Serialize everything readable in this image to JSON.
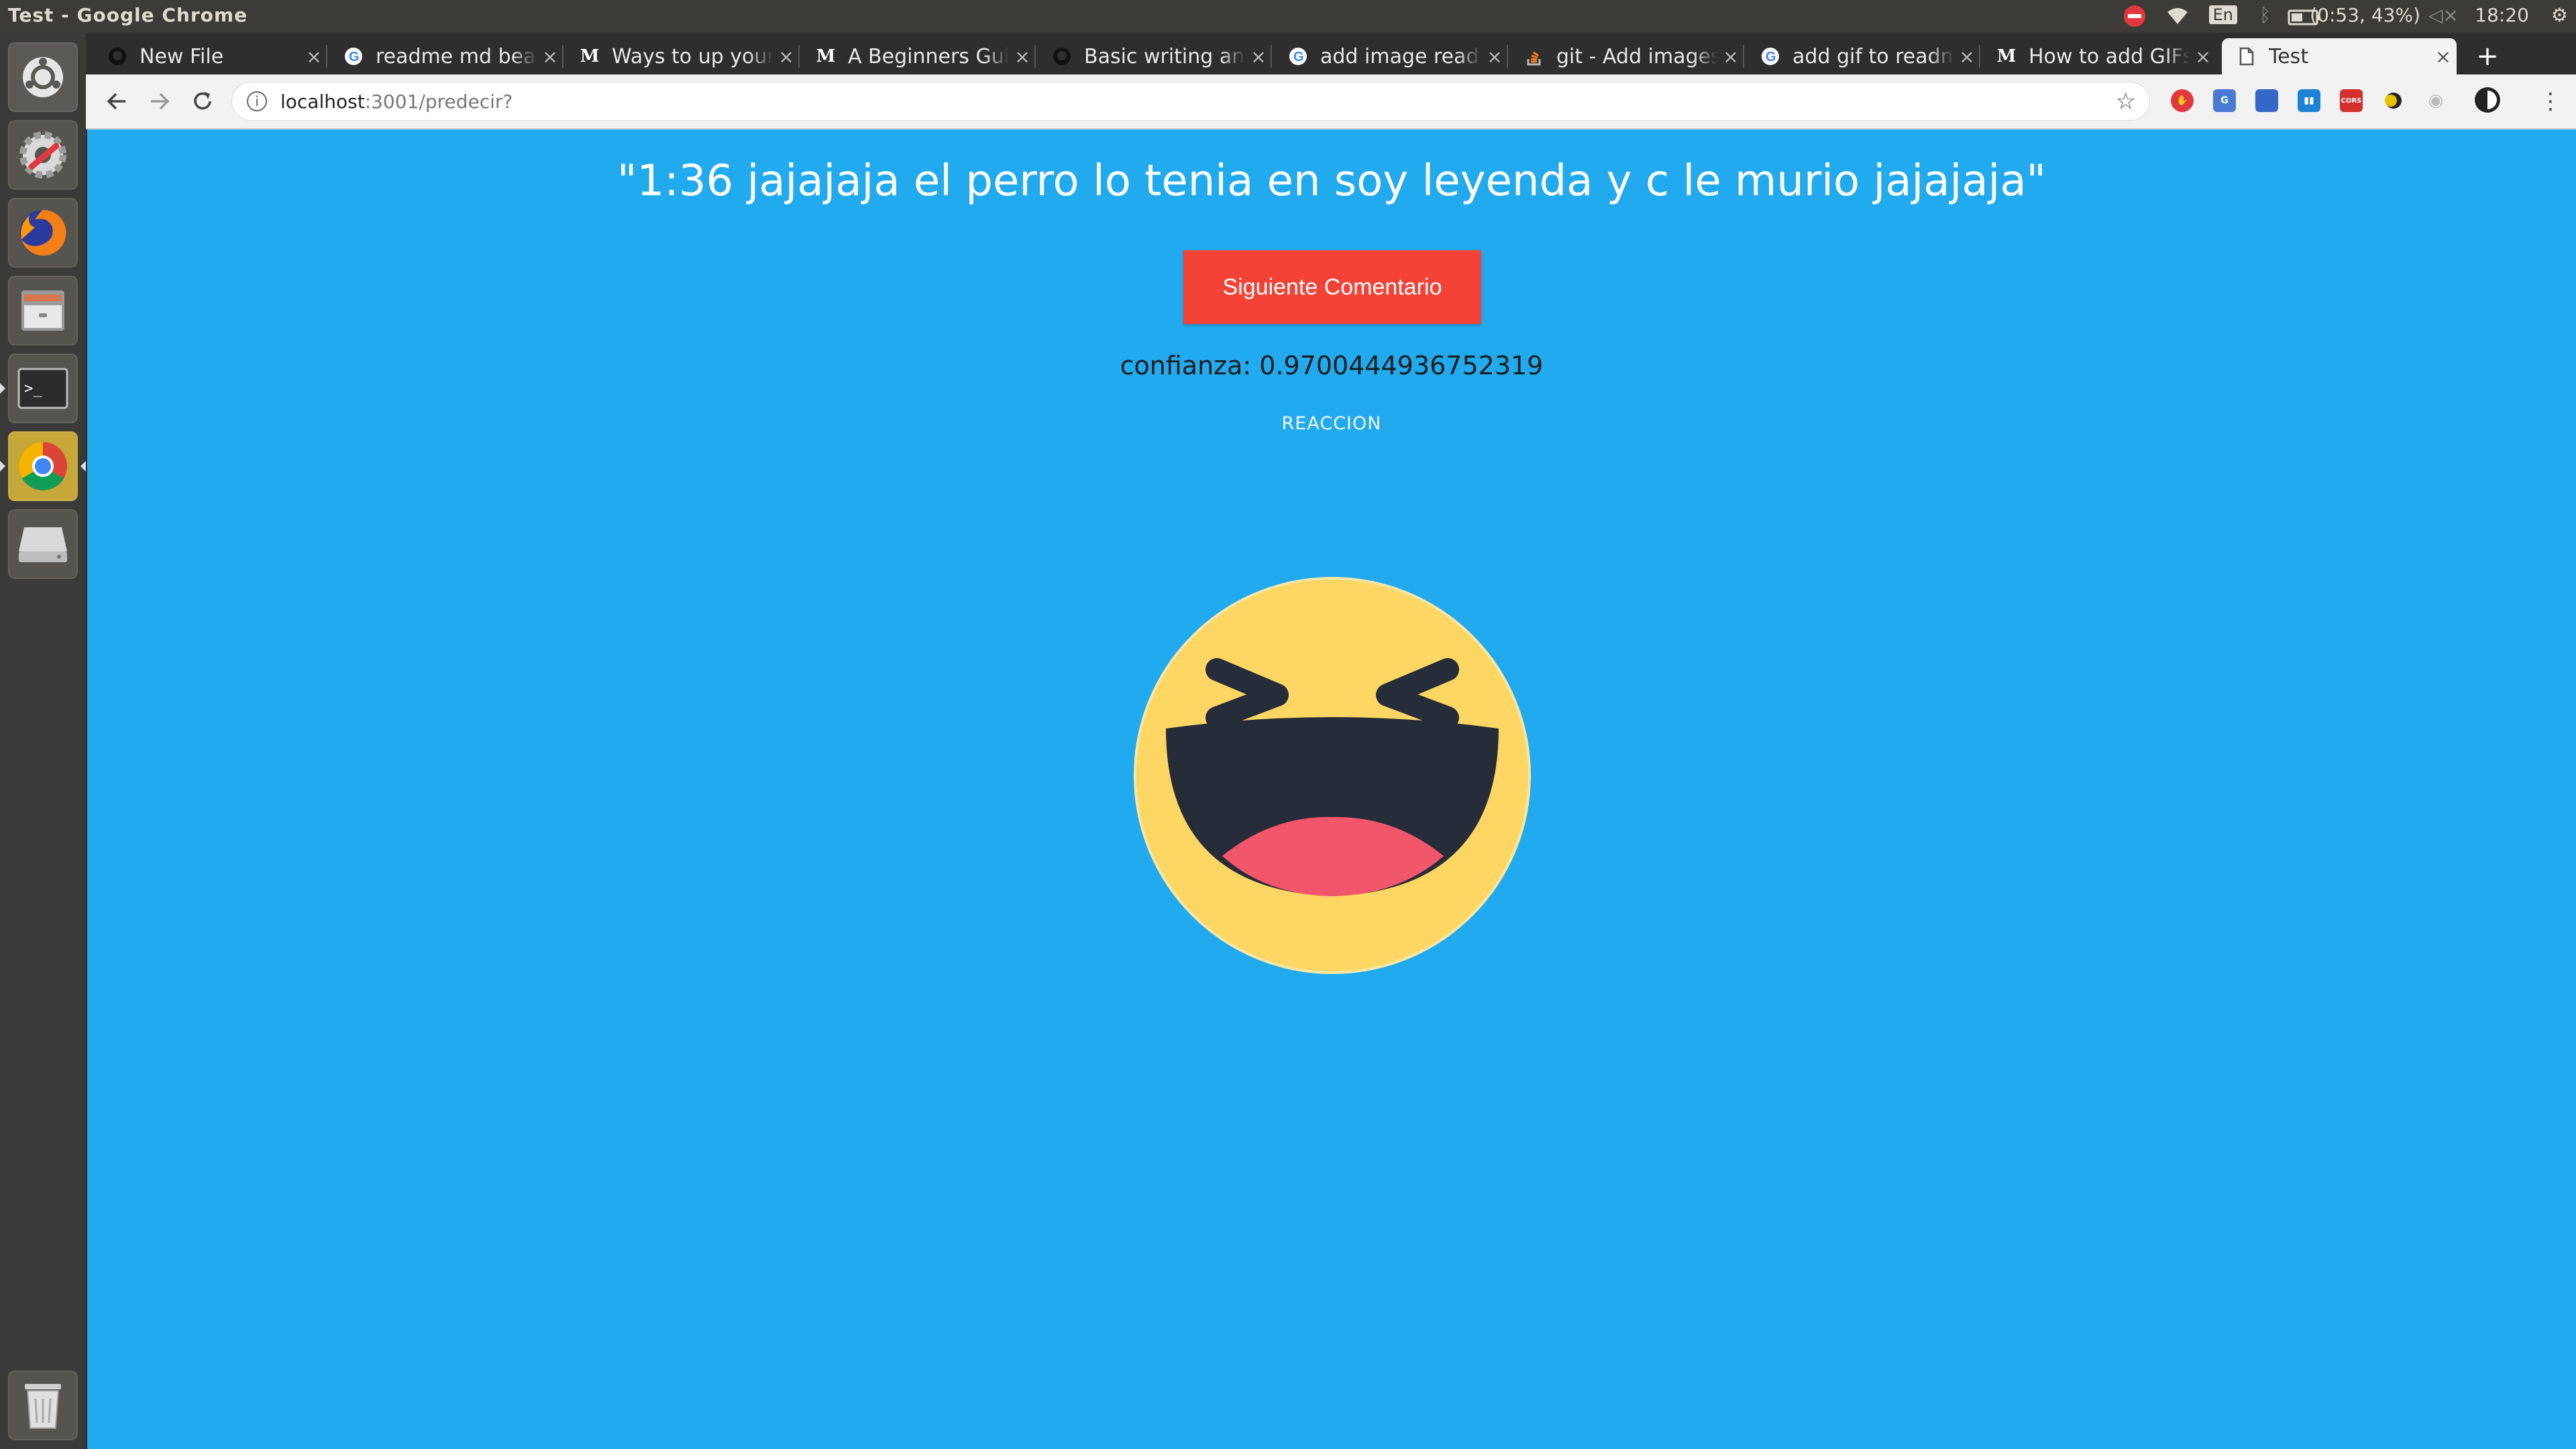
{
  "os": {
    "window_title": "Test - Google Chrome",
    "indicators": {
      "keyboard_layout": "En",
      "battery": "(0:53, 43%)",
      "clock": "18:20"
    },
    "launcher_items": [
      {
        "name": "ubuntu-dash-icon"
      },
      {
        "name": "system-settings-icon"
      },
      {
        "name": "firefox-icon"
      },
      {
        "name": "file-manager-icon"
      },
      {
        "name": "terminal-icon"
      },
      {
        "name": "chrome-icon"
      },
      {
        "name": "disk-drive-icon"
      },
      {
        "name": "trash-icon"
      }
    ]
  },
  "browser": {
    "tabs": [
      {
        "title": "New File",
        "favicon": "github-icon"
      },
      {
        "title": "readme md beautiful",
        "favicon": "google-icon"
      },
      {
        "title": "Ways to up your",
        "favicon": "medium-icon"
      },
      {
        "title": "A Beginners Guide",
        "favicon": "medium-icon"
      },
      {
        "title": "Basic writing and",
        "favicon": "github-icon"
      },
      {
        "title": "add image readme",
        "favicon": "google-icon"
      },
      {
        "title": "git - Add images",
        "favicon": "stackoverflow-icon"
      },
      {
        "title": "add gif to readme",
        "favicon": "google-icon"
      },
      {
        "title": "How to add GIFs",
        "favicon": "medium-icon"
      },
      {
        "title": "Test",
        "favicon": "page-icon",
        "active": true
      }
    ],
    "url": {
      "host": "localhost",
      "rest": ":3001/predecir?"
    }
  },
  "page": {
    "comment": "\"1:36 jajajaja el perro lo tenia en soy leyenda y c le murio jajajaja\"",
    "next_button": "Siguiente Comentario",
    "confidence": "confianza: 0.9700444936752319",
    "reaction_label": "REACCION",
    "reaction_icon": "laughing-face-icon"
  },
  "colors": {
    "page_background": "#22aaee",
    "button": "#f44336",
    "emoji_face": "#fdd663",
    "emoji_tongue": "#f2566b"
  }
}
